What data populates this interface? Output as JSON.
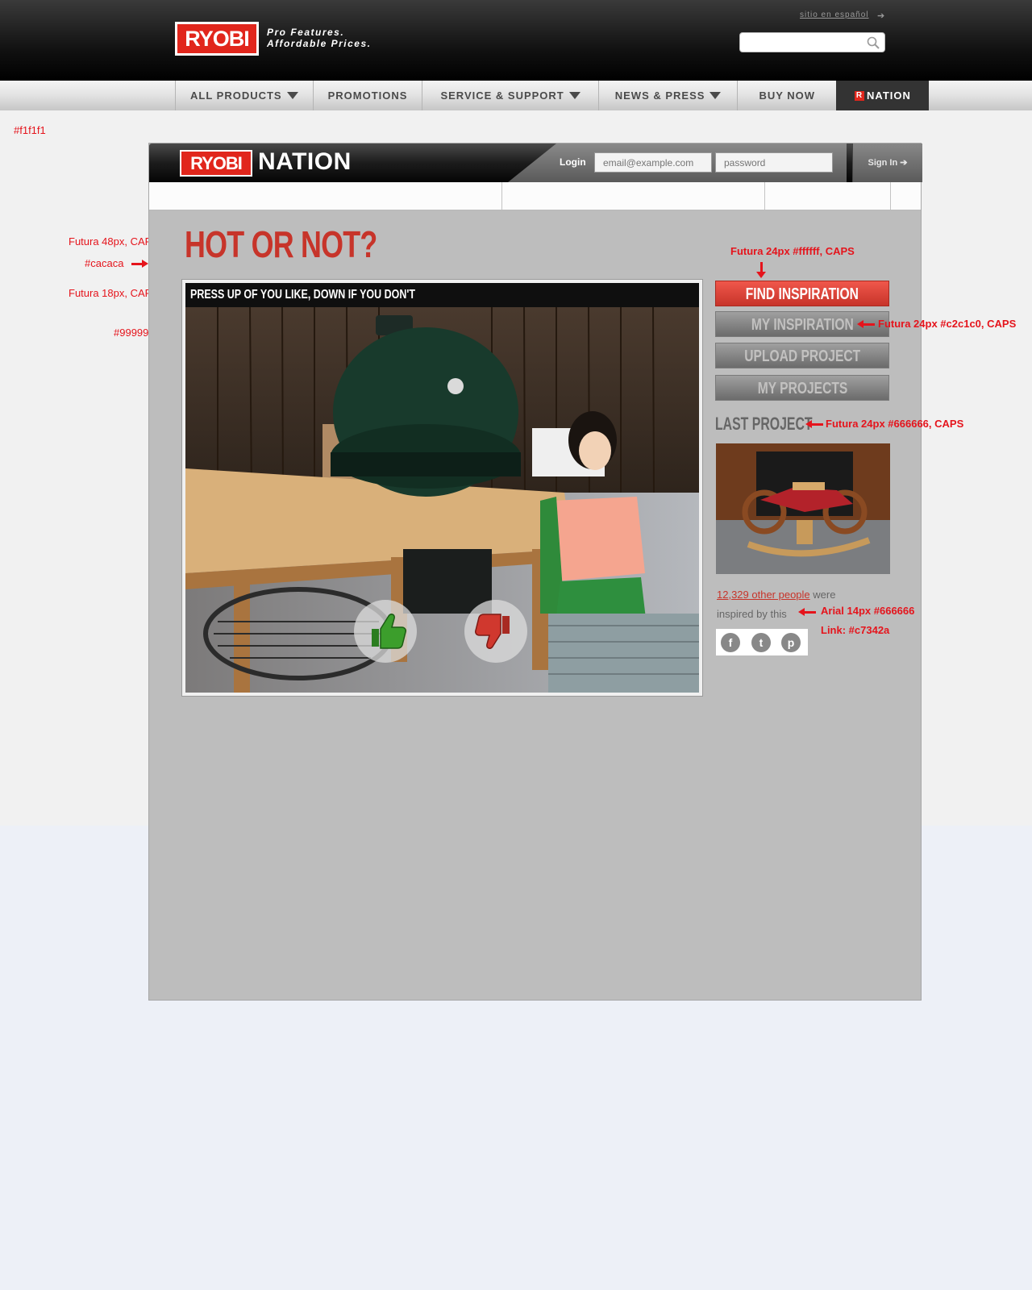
{
  "header": {
    "logo": "RYOBI",
    "tagline_1": "Pro Features.",
    "tagline_2": "Affordable Prices.",
    "language_link": "sitio en español",
    "search_placeholder": ""
  },
  "nav": {
    "items": [
      {
        "label": "ALL PRODUCTS",
        "dropdown": true
      },
      {
        "label": "PROMOTIONS",
        "dropdown": false
      },
      {
        "label": "SERVICE & SUPPORT",
        "dropdown": true
      },
      {
        "label": "NEWS & PRESS",
        "dropdown": true
      },
      {
        "label": "BUY NOW",
        "dropdown": false
      },
      {
        "label": "NATION",
        "dropdown": false
      }
    ]
  },
  "nation": {
    "logo": "RYOBI",
    "word": "NATION",
    "login_label": "Login",
    "email_placeholder": "email@example.com",
    "password_placeholder": "password",
    "signin_label": "Sign In ➔"
  },
  "content": {
    "title": "HOT OR NOT?",
    "instruction": "PRESS UP OF YOU LIKE, DOWN IF YOU DON'T",
    "buttons": [
      "FIND INSPIRATION",
      "MY INSPIRATION",
      "UPLOAD PROJECT",
      "MY PROJECTS"
    ],
    "last_project_label": "LAST PROJECT",
    "inspired_count_link": "12,329 other people",
    "inspired_text_1": "were",
    "inspired_text_2": "inspired by this",
    "share_icons": [
      "facebook-icon",
      "twitter-icon",
      "pinterest-icon"
    ]
  },
  "annotations": {
    "page_bg": "#f1f1f1",
    "panel_bg": "#bdbdbd",
    "title_font": "Futura 48px, CAPS",
    "title_color": "#cacaca",
    "bar_font": "Futura 18px, CAPS",
    "frame_color": "#999999",
    "red_btn_font": "Futura 24px #ffffff, CAPS",
    "gray_btn_font": "Futura 24px #c2c1c0, CAPS",
    "last_project_font": "Futura 24px #666666, CAPS",
    "body_font": "Arial 14px #666666",
    "link_color": "Link: #c7342a"
  },
  "colors": {
    "brand_red": "#e1261c",
    "link": "#c7342a"
  }
}
